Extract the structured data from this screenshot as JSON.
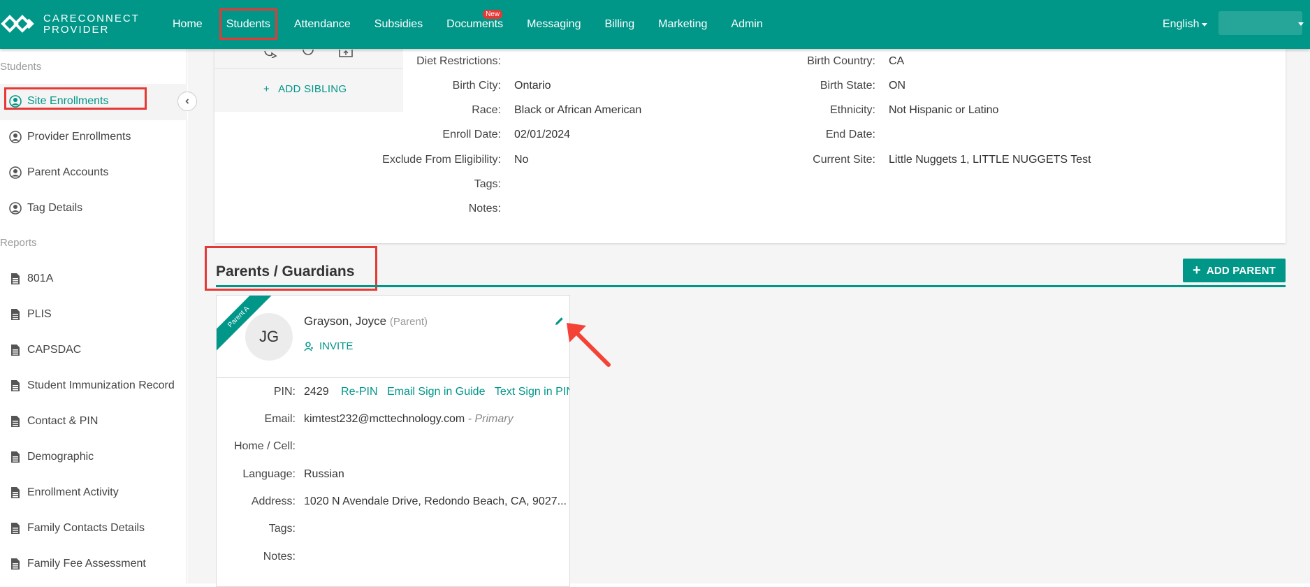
{
  "brand": {
    "line1": "CARECONNECT",
    "line2": "PROVIDER"
  },
  "nav": {
    "items": [
      {
        "label": "Home"
      },
      {
        "label": "Students"
      },
      {
        "label": "Attendance"
      },
      {
        "label": "Subsidies"
      },
      {
        "label": "Documents",
        "badge": "New"
      },
      {
        "label": "Messaging"
      },
      {
        "label": "Billing"
      },
      {
        "label": "Marketing"
      },
      {
        "label": "Admin"
      }
    ],
    "language": "English"
  },
  "sidebar": {
    "section_students": "Students",
    "students_items": [
      {
        "label": "Site Enrollments",
        "icon": "user-circle-icon"
      },
      {
        "label": "Provider Enrollments",
        "icon": "user-circle-icon"
      },
      {
        "label": "Parent Accounts",
        "icon": "user-circle-icon"
      },
      {
        "label": "Tag Details",
        "icon": "user-circle-icon"
      }
    ],
    "section_reports": "Reports",
    "reports_items": [
      {
        "label": "801A"
      },
      {
        "label": "PLIS"
      },
      {
        "label": "CAPSDAC"
      },
      {
        "label": "Student Immunization Record"
      },
      {
        "label": "Contact & PIN"
      },
      {
        "label": "Demographic"
      },
      {
        "label": "Enrollment Activity"
      },
      {
        "label": "Family Contacts Details"
      },
      {
        "label": "Family Fee Assessment"
      }
    ]
  },
  "student": {
    "add_sibling": "ADD SIBLING",
    "left_fields": [
      {
        "label": "Diet Restrictions:",
        "value": ""
      },
      {
        "label": "Birth City:",
        "value": "Ontario"
      },
      {
        "label": "Race:",
        "value": "Black or African American"
      },
      {
        "label": "Enroll Date:",
        "value": "02/01/2024"
      },
      {
        "label": "Exclude From Eligibility:",
        "value": "No"
      },
      {
        "label": "Tags:",
        "value": ""
      },
      {
        "label": "Notes:",
        "value": ""
      }
    ],
    "right_fields": [
      {
        "label": "Birth Country:",
        "value": "CA"
      },
      {
        "label": "Birth State:",
        "value": "ON"
      },
      {
        "label": "Ethnicity:",
        "value": "Not Hispanic or Latino"
      },
      {
        "label": "End Date:",
        "value": ""
      },
      {
        "label": "Current Site:",
        "value": "Little Nuggets 1, LITTLE NUGGETS Test"
      }
    ]
  },
  "parents": {
    "section_title": "Parents / Guardians",
    "add_parent": "ADD PARENT",
    "card": {
      "ribbon": "Parent A",
      "initials": "JG",
      "name": "Grayson, Joyce",
      "role": "(Parent)",
      "invite": "INVITE",
      "pin_label": "PIN:",
      "pin": "2429",
      "repin": "Re-PIN",
      "email_guide": "Email Sign in Guide",
      "text_pin": "Text Sign in PIN",
      "email_label": "Email:",
      "email": "kimtest232@mcttechnology.com",
      "email_tag": "- Primary",
      "phone_label": "Home / Cell:",
      "phone": "",
      "language_label": "Language:",
      "language": "Russian",
      "address_label": "Address:",
      "address": "1020 N Avendale Drive, Redondo Beach, CA, 9027...",
      "tags_label": "Tags:",
      "tags": "",
      "notes_label": "Notes:",
      "notes": ""
    }
  },
  "colors": {
    "primary": "#009688",
    "highlight": "#e53935"
  }
}
